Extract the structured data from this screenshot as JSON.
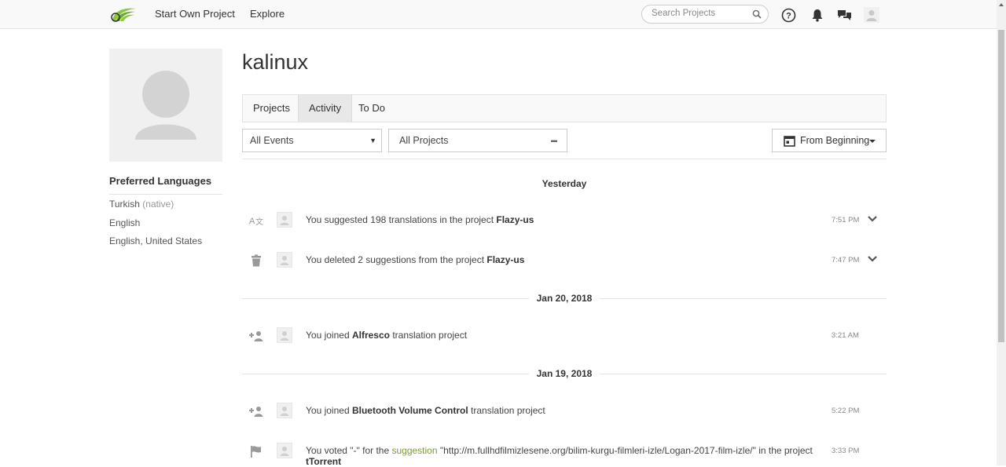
{
  "nav": {
    "start_own_project": "Start Own Project",
    "explore": "Explore",
    "search_placeholder": "Search Projects"
  },
  "profile": {
    "username": "kalinux",
    "preferred_languages_title": "Preferred Languages",
    "languages": [
      {
        "name": "Turkish",
        "note": "(native)"
      },
      {
        "name": "English",
        "note": ""
      },
      {
        "name": "English, United States",
        "note": ""
      }
    ]
  },
  "tabs": [
    {
      "label": "Projects",
      "active": false
    },
    {
      "label": "Activity",
      "active": true
    },
    {
      "label": "To Do",
      "active": false
    }
  ],
  "filters": {
    "events": "All Events",
    "projects": "All Projects",
    "from": "From Beginning"
  },
  "groups": [
    {
      "date": "Yesterday",
      "items": [
        {
          "icon": "translate-icon",
          "pre": "You suggested 198 translations in the project ",
          "bold": "Flazy-us",
          "post": "",
          "time": "7:51 PM",
          "expandable": true
        },
        {
          "icon": "trash-icon",
          "pre": "You deleted 2 suggestions from the project ",
          "bold": "Flazy-us",
          "post": "",
          "time": "7:47 PM",
          "expandable": true
        }
      ]
    },
    {
      "date": "Jan 20, 2018",
      "items": [
        {
          "icon": "join-user-icon",
          "pre": "You joined ",
          "bold": "Alfresco",
          "post": " translation project",
          "time": "3:21 AM",
          "expandable": false
        }
      ]
    },
    {
      "date": "Jan 19, 2018",
      "items": [
        {
          "icon": "join-user-icon",
          "pre": "You joined ",
          "bold": "Bluetooth Volume Control",
          "post": " translation project",
          "time": "5:22 PM",
          "expandable": false
        },
        {
          "icon": "flag-icon",
          "pre": "You voted \"-\" for the ",
          "link": "suggestion",
          "mid": " \"http://m.fullhdfilmizlesene.org/bilim-kurgu-filmleri-izle/Logan-2017-film-izle/\" in the project",
          "bold": "tTorrent",
          "time": "3:33 PM",
          "expandable": false
        }
      ]
    }
  ],
  "colors": {
    "logo_green": "#8cc63f",
    "link_green": "#7a9a3c",
    "icon_gray": "#999999"
  }
}
